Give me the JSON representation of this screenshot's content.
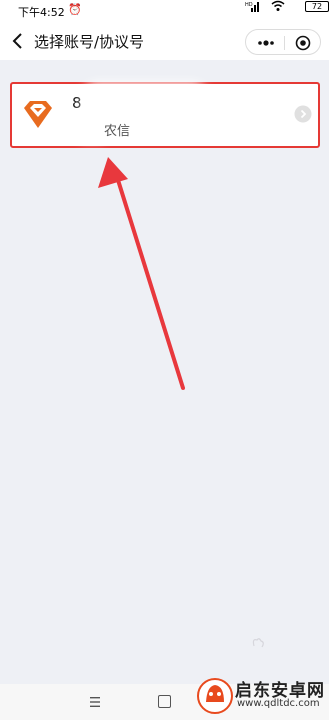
{
  "status_bar": {
    "time": "下午4:52",
    "signal_label": "HD",
    "battery": "72"
  },
  "nav": {
    "title": "选择账号/协议号"
  },
  "accounts": [
    {
      "number_visible": "8",
      "bank_name": "农信"
    }
  ],
  "watermark": {
    "name": "启东安卓网",
    "url": "www.qdltdc.com"
  },
  "colors": {
    "highlight_border": "#e53935",
    "arrow": "#e8383d",
    "logo": "#e86b1f"
  }
}
